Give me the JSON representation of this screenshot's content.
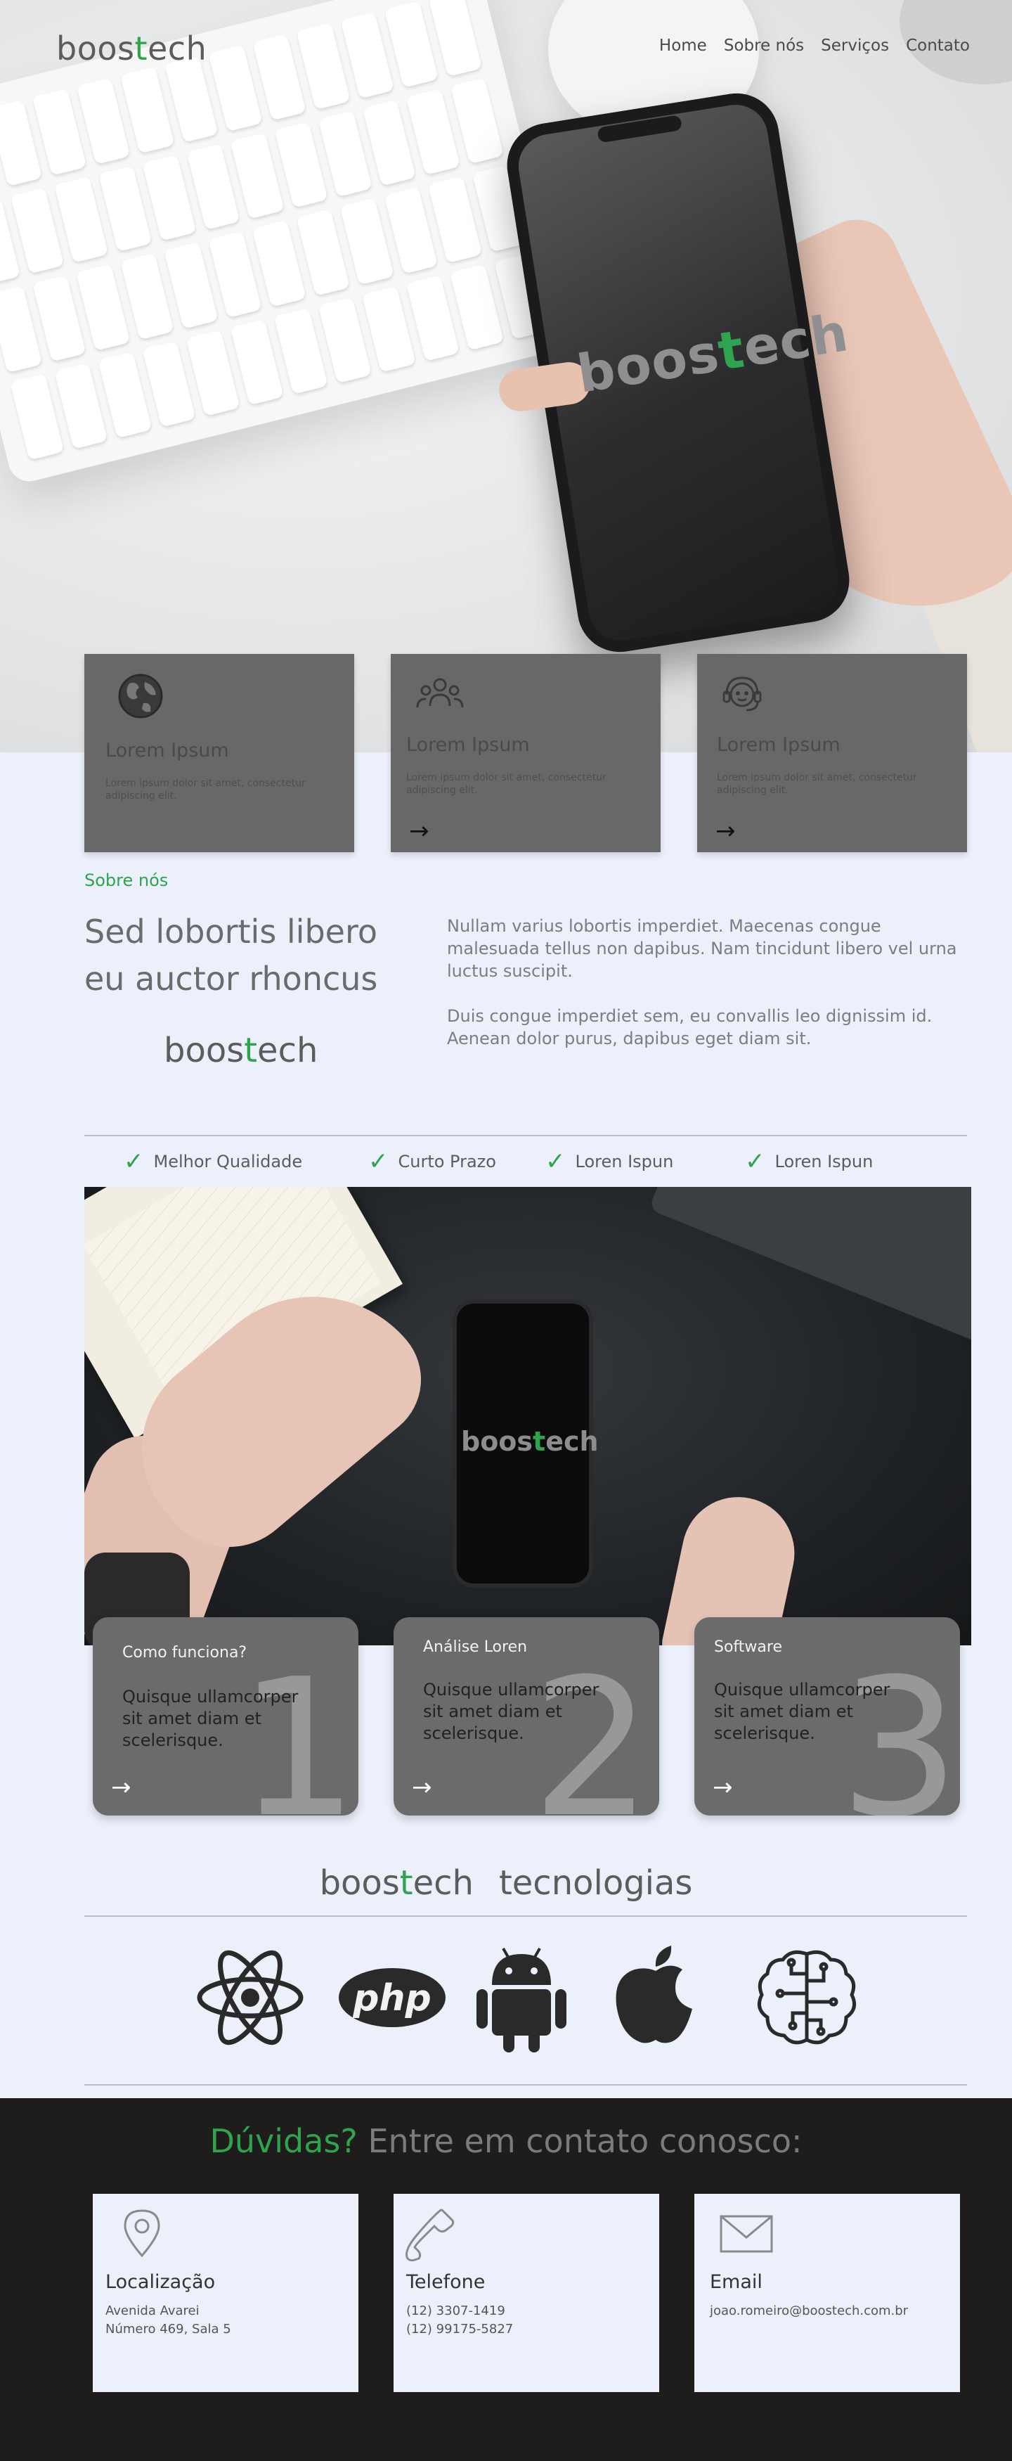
{
  "header": {
    "logo": {
      "pre": "boos",
      "t": "t",
      "post": "ech"
    },
    "nav": [
      "Home",
      "Sobre nós",
      "Serviços",
      "Contato"
    ]
  },
  "hero": {
    "phone_logo": {
      "pre": "boos",
      "t": "t",
      "post": "ech"
    }
  },
  "features": [
    {
      "icon": "globe-icon",
      "title": "Lorem Ipsum",
      "desc": "Lorem ipsum dolor sit amet, consectetur adipiscing elit.",
      "arrow": "→"
    },
    {
      "icon": "team-icon",
      "title": "Lorem Ipsum",
      "desc": "Lorem ipsum dolor sit amet, consectetur adipiscing elit.",
      "arrow": "→"
    },
    {
      "icon": "headset-icon",
      "title": "Lorem Ipsum",
      "desc": "Lorem ipsum dolor sit amet, consectetur adipiscing elit.",
      "arrow": "→"
    }
  ],
  "about": {
    "tag": "Sobre nós",
    "heading": "Sed lobortis libero eu auctor rhoncus",
    "logo": {
      "pre": "boos",
      "t": "t",
      "post": "ech"
    },
    "p1": "Nullam varius lobortis imperdiet. Maecenas congue malesuada tellus non dapibus. Nam tincidunt libero vel urna luctus suscipit.",
    "p2": "Duis congue imperdiet sem, eu convallis leo dignissim id. Aenean dolor purus, dapibus eget diam sit."
  },
  "benefits": [
    "Melhor Qualidade",
    "Curto Prazo",
    "Loren Ispun",
    "Loren Ispun"
  ],
  "benefit_mark": "✓",
  "photo": {
    "phone_logo": {
      "pre": "boos",
      "t": "t",
      "post": "ech"
    }
  },
  "steps": [
    {
      "title": "Como funciona?",
      "desc": "Quisque ullamcorper sit amet diam et scelerisque.",
      "num": "1",
      "arrow": "→"
    },
    {
      "title": "Análise Loren",
      "desc": "Quisque ullamcorper sit amet diam et scelerisque.",
      "num": "2",
      "arrow": "→"
    },
    {
      "title": "Software",
      "desc": "Quisque ullamcorper sit amet diam et scelerisque.",
      "num": "3",
      "arrow": "→"
    }
  ],
  "tech": {
    "title": {
      "pre": "boos",
      "t": "t",
      "post": "ech",
      "word": "tecnologias"
    },
    "icons": [
      "react-atom-icon",
      "php-icon",
      "android-icon",
      "apple-icon",
      "brain-icon"
    ],
    "php_label": "php"
  },
  "contact": {
    "q": "Dúvidas?",
    "rest": "Entre em contato conosco:",
    "cards": [
      {
        "icon": "location-pin-icon",
        "title": "Localização",
        "line1": "Avenida Avarei",
        "line2": "Número 469, Sala 5"
      },
      {
        "icon": "phone-icon",
        "title": "Telefone",
        "line1": "(12) 3307-1419",
        "line2": "(12) 99175-5827"
      },
      {
        "icon": "email-icon",
        "title": "Email",
        "line1": "joao.romeiro@boostech.com.br",
        "line2": ""
      }
    ]
  },
  "colors": {
    "brand_green": "#2ea44f",
    "card_gray": "#686868",
    "page_bg": "#ecf0fb",
    "footer_bg": "#1f1c1c"
  }
}
